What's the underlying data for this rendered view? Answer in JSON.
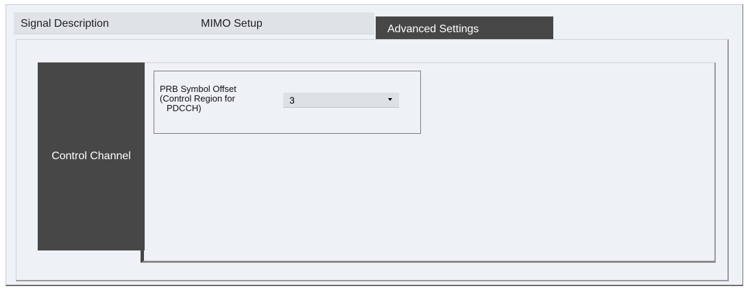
{
  "tabs": [
    {
      "label": "Signal Description",
      "active": false
    },
    {
      "label": "MIMO Setup",
      "active": false
    },
    {
      "label": "Advanced Settings",
      "active": true
    }
  ],
  "side_tabs": [
    {
      "label": "Control Channel",
      "active": true
    }
  ],
  "control_channel": {
    "prb_symbol_offset": {
      "label_line1": "PRB Symbol Offset",
      "label_line2": "(Control Region for",
      "label_line3": "PDCCH)",
      "value": "3"
    }
  },
  "colors": {
    "active_tab_bg": "#474747",
    "inactive_tab_bg": "#dfe3e8",
    "panel_bg": "#eef1f6"
  }
}
